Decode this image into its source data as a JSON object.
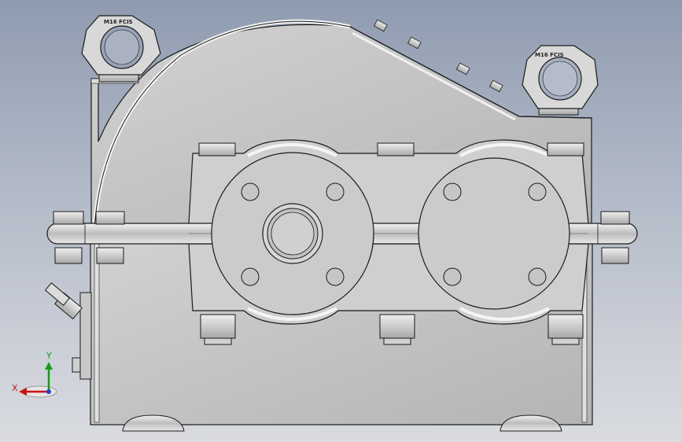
{
  "viewport": {
    "background_top": "#8f9bb0",
    "background_bottom": "#d9dbe0"
  },
  "model": {
    "body_color": "#c4c4c4",
    "edge_color": "#1a1a1a",
    "eyebolt_left_text": "M16 FCIS",
    "eyebolt_right_text": "M16 FCIS"
  },
  "triad": {
    "x_label": "X",
    "y_label": "Y",
    "x_color": "#d01010",
    "y_color": "#10a010",
    "z_color": "#2040d0"
  }
}
